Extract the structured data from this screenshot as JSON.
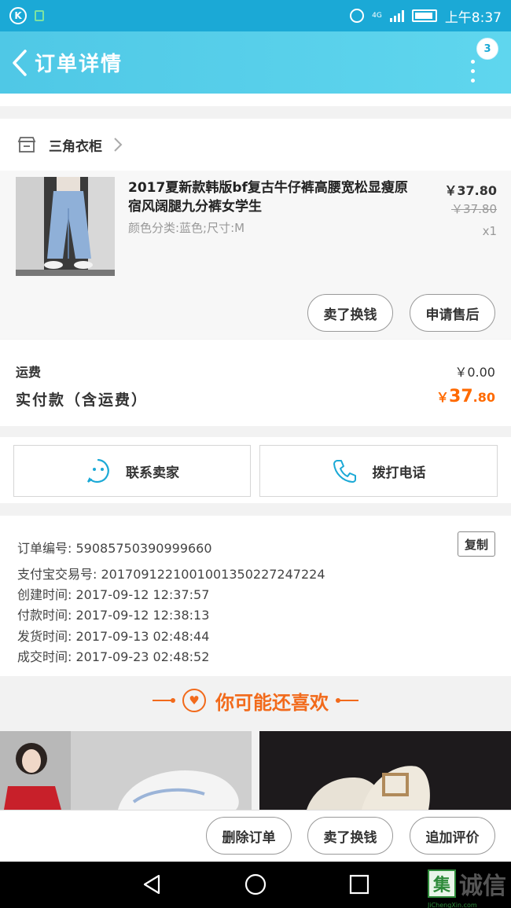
{
  "status_bar": {
    "time": "上午8:37",
    "network": "4G"
  },
  "header": {
    "title": "订单详情",
    "badge_count": "3"
  },
  "shop": {
    "name": "三角衣柜"
  },
  "product": {
    "title": "2017夏新款韩版bf复古牛仔裤高腰宽松显瘦原宿风阔腿九分裤女学生",
    "sku": "颜色分类:蓝色;尺寸:M",
    "price": "￥37.80",
    "original_price": "￥37.80",
    "quantity": "x1",
    "buttons": {
      "sell_exchange": "卖了换钱",
      "after_sale": "申请售后"
    }
  },
  "fees": {
    "shipping_label": "运费",
    "shipping_value": "￥0.00",
    "total_label": "实付款（含运费）",
    "total_currency": "￥",
    "total_int": "37",
    "total_dec": ".80"
  },
  "contact": {
    "seller": "联系卖家",
    "phone": "拨打电话"
  },
  "order_info": {
    "order_no": "订单编号: 59085750390999660",
    "alipay_no": "支付宝交易号: 2017091221001001350227247224",
    "created": "创建时间: 2017-09-12 12:37:57",
    "paid": "付款时间: 2017-09-12 12:38:13",
    "shipped": "发货时间: 2017-09-13 02:48:44",
    "completed": "成交时间: 2017-09-23 02:48:52",
    "copy_label": "复制"
  },
  "recommend": {
    "title": "你可能还喜欢"
  },
  "actions": {
    "delete": "删除订单",
    "sell": "卖了换钱",
    "review": "追加评价"
  },
  "watermark": {
    "mark": "集",
    "text": "诚信",
    "sub": "JiChengXin.com"
  },
  "colors": {
    "header": "#4fc8e6",
    "accent": "#f26a1b",
    "contact_icon": "#1ba9d6"
  }
}
